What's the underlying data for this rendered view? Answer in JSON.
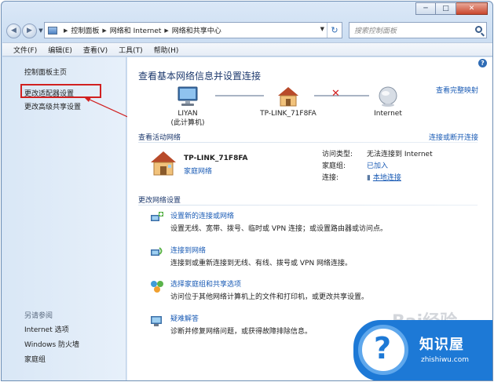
{
  "window": {
    "controls": {
      "minimize": "─",
      "maximize": "□",
      "close": "✕"
    }
  },
  "address_bar": {
    "crumbs": [
      "控制面板",
      "网络和 Internet",
      "网络和共享中心"
    ],
    "search_placeholder": "搜索控制面板"
  },
  "menu": [
    "文件(F)",
    "编辑(E)",
    "查看(V)",
    "工具(T)",
    "帮助(H)"
  ],
  "sidebar": {
    "links": [
      "控制面板主页",
      "更改适配器设置",
      "更改高级共享设置"
    ],
    "see_also_title": "另请参阅",
    "see_also": [
      "Internet 选项",
      "Windows 防火墙",
      "家庭组"
    ]
  },
  "main": {
    "title": "查看基本网络信息并设置连接",
    "full_map_link": "查看完整映射",
    "map_nodes": [
      {
        "line1": "LIYAN",
        "line2": "(此计算机)"
      },
      {
        "line1": "TP-LINK_71F8FA",
        "line2": ""
      },
      {
        "line1": "Internet",
        "line2": ""
      }
    ],
    "active_header": "查看活动网络",
    "connect_link": "连接或断开连接",
    "active_network": {
      "name": "TP-LINK_71F8FA",
      "type": "家庭网络",
      "props": [
        {
          "key": "访问类型:",
          "value": "无法连接到 Internet"
        },
        {
          "key": "家庭组:",
          "value": "已加入"
        },
        {
          "key": "连接:",
          "value": "本地连接"
        }
      ]
    },
    "change_header": "更改网络设置",
    "tasks": [
      {
        "title": "设置新的连接或网络",
        "desc": "设置无线、宽带、拨号、临时或 VPN 连接；或设置路由器或访问点。",
        "icon": "new-connection-icon"
      },
      {
        "title": "连接到网络",
        "desc": "连接到或重新连接到无线、有线、拨号或 VPN 网络连接。",
        "icon": "connect-network-icon"
      },
      {
        "title": "选择家庭组和共享选项",
        "desc": "访问位于其他网络计算机上的文件和打印机，或更改共享设置。",
        "icon": "homegroup-icon"
      },
      {
        "title": "疑难解答",
        "desc": "诊断并修复网络问题，或获得故障排除信息。",
        "icon": "troubleshoot-icon"
      }
    ]
  },
  "watermark": {
    "baidu_text": "Bai经验",
    "brand_name": "知识屋",
    "brand_url": "zhishiwu.com",
    "brand_color": "#1d79d6"
  }
}
